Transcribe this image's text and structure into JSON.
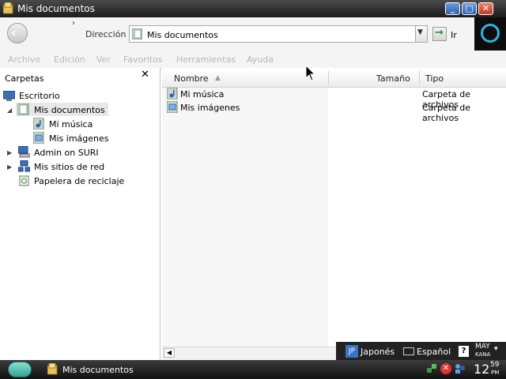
{
  "window": {
    "title": "Mis documentos",
    "controls": {
      "minimize": "_",
      "maximize": "□",
      "close": "✕"
    }
  },
  "toolbar": {
    "back_icon": "back-arrow-icon",
    "chevron": "›",
    "address_label": "Dirección",
    "address_value": "Mis documentos",
    "go_label": "Ir"
  },
  "menu": [
    "Archivo",
    "Edición",
    "Ver",
    "Favoritos",
    "Herramientas",
    "Ayuda"
  ],
  "folders_pane": {
    "title": "Carpetas",
    "close": "✕",
    "tree": [
      {
        "label": "Escritorio",
        "icon": "desktop-icon"
      },
      {
        "label": "Mis documentos",
        "icon": "documents-folder-icon",
        "selected": true
      },
      {
        "label": "Mi música",
        "icon": "music-folder-icon"
      },
      {
        "label": "Mis imágenes",
        "icon": "pictures-folder-icon"
      },
      {
        "label": "Admin on SURI",
        "icon": "computer-icon"
      },
      {
        "label": "Mis sitios de red",
        "icon": "network-icon"
      },
      {
        "label": "Papelera de reciclaje",
        "icon": "recycle-bin-icon"
      }
    ]
  },
  "file_list": {
    "columns": [
      "Nombre",
      "Tamaño",
      "Tipo"
    ],
    "rows": [
      {
        "name": "Mi música",
        "type": "Carpeta de archivos"
      },
      {
        "name": "Mis imágenes",
        "type": "Carpeta de archivos"
      }
    ]
  },
  "language_bar": {
    "jp_badge": "JP",
    "jp_label": "Japonés",
    "es_label": "Español",
    "help": "?",
    "mode_top": "MAY",
    "mode_bottom": "KANA"
  },
  "taskbar": {
    "task_label": "Mis documentos",
    "clock_hour": "12",
    "clock_min": "59",
    "clock_ampm": "PM"
  },
  "colors": {
    "title_bg": "#1d1d1d",
    "accent_blue": "#2d5fb3",
    "close_red": "#c2381d",
    "folder_yellow": "#e8c35a"
  }
}
